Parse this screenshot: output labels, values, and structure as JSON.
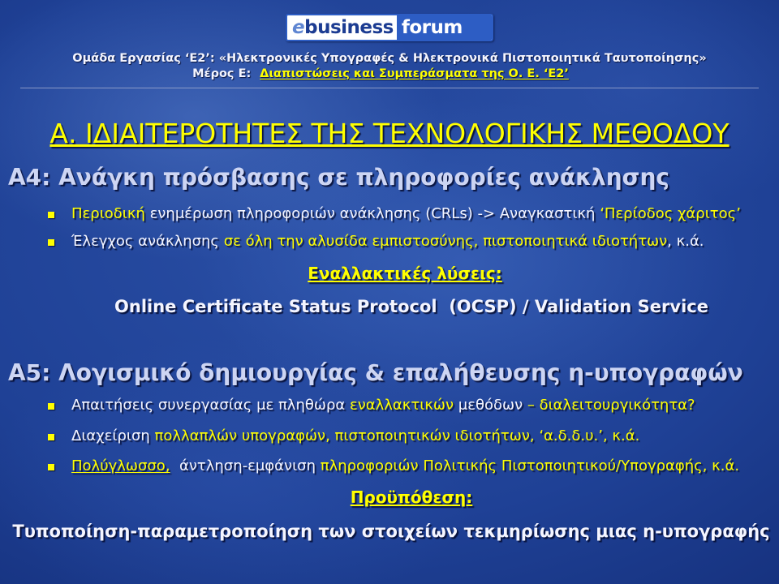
{
  "colors": {
    "background": "#1f4196",
    "accent_yellow": "#ffff00",
    "text_white": "#f4f5ff",
    "heading_light": "#cdd5f3",
    "logo_blue": "#2d5dc4"
  },
  "logo": {
    "part1": "e",
    "part2": "business",
    "part3": "forum"
  },
  "header": {
    "line1": "Ομάδα Εργασίας ‘Ε2’: «Ηλεκτρονικές Υπογραφές & Ηλεκτρονικά Πιστοποιητικά Ταυτοποίησης»",
    "part_label": "Μέρος Ε:",
    "part_title": "Διαπιστώσεις και Συμπεράσματα της Ο. Ε. ‘Ε2’"
  },
  "title": "Α. ΙΔΙΑΙΤΕΡΟΤΗΤΕΣ ΤΗΣ ΤΕΧΝΟΛΟΓΙΚΗΣ ΜΕΘΟΔΟΥ",
  "section_a4": {
    "heading": "Α4: Ανάγκη πρόσβασης σε πληροφορίες ανάκλησης",
    "bullets": [
      {
        "segments": [
          {
            "text": "Περιοδική",
            "highlight": true
          },
          {
            "text": " ενημέρωση πληροφοριών ανάκλησης (CRLs) -> Αναγκαστική ",
            "highlight": false
          },
          {
            "text": "‘Περίοδος χάριτος’",
            "highlight": true
          }
        ]
      },
      {
        "segments": [
          {
            "text": "Έλεγχος ανάκλησης ",
            "highlight": false
          },
          {
            "text": "σε όλη την αλυσίδα εμπιστοσύνης, πιστοποιητικά ιδιοτήτων",
            "highlight": true
          },
          {
            "text": ", κ.ά.",
            "highlight": false
          }
        ]
      }
    ],
    "alternatives_label": "Εναλλακτικές λύσεις:",
    "alternatives_value": "Online Certificate Status Protocol  (OCSP) / Validation Service"
  },
  "section_a5": {
    "heading": "Α5: Λογισμικό δημιουργίας & επαλήθευσης η-υπογραφών",
    "bullets": [
      {
        "segments": [
          {
            "text": "Απαιτήσεις συνεργασίας με πληθώρα ",
            "highlight": false
          },
          {
            "text": "εναλλακτικών",
            "highlight": true
          },
          {
            "text": " μεθόδων ",
            "highlight": false
          },
          {
            "text": "– διαλειτουργικότητα?",
            "highlight": true
          }
        ]
      },
      {
        "segments": [
          {
            "text": "Διαχείριση ",
            "highlight": false
          },
          {
            "text": "πολλαπλών υπογραφών, πιστοποιητικών ιδιοτήτων, ‘α.δ.δ.υ.’, κ.ά.",
            "highlight": true
          }
        ]
      },
      {
        "segments": [
          {
            "text": "Πολύγλωσσο,",
            "highlight": true
          },
          {
            "text": "  άντληση-εμφάνιση ",
            "highlight": false
          },
          {
            "text": "πληροφοριών Πολιτικής Πιστοποιητικού/Υπογραφής, κ.ά.",
            "highlight": true
          }
        ]
      }
    ],
    "prerequisite_label": "Προϋπόθεση:",
    "prerequisite_value": "Τυποποίηση-παραμετροποίηση των στοιχείων τεκμηρίωσης μιας η-υπογραφής"
  }
}
